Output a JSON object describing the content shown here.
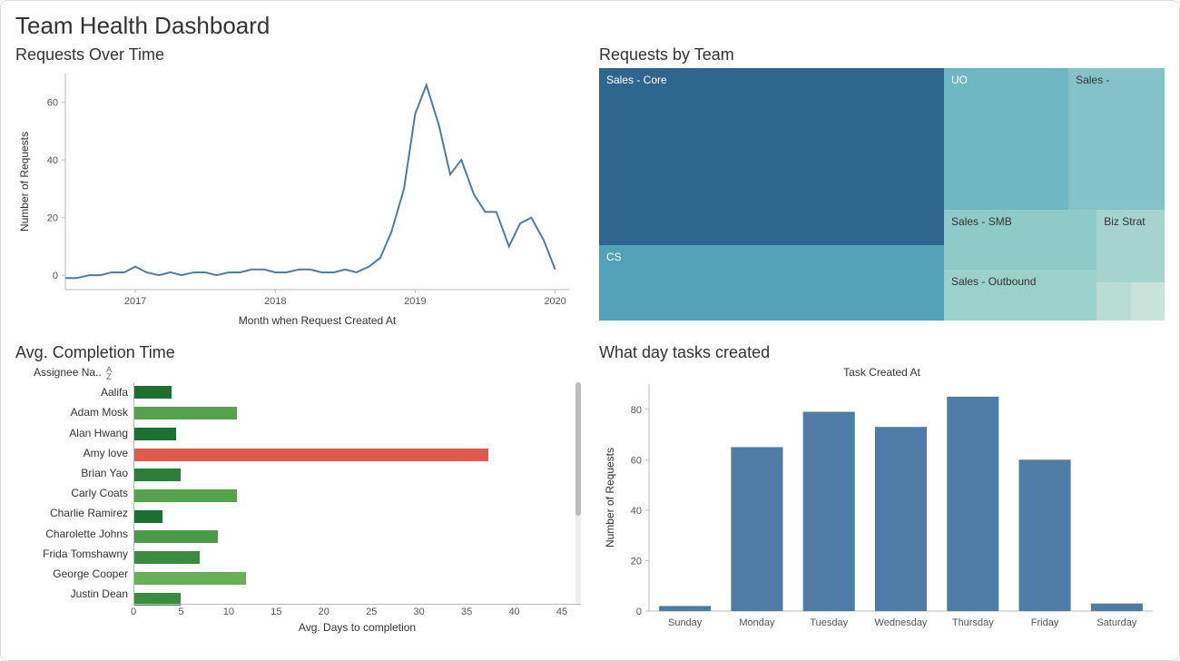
{
  "title": "Team Health Dashboard",
  "chart_data": [
    {
      "id": "requests_over_time",
      "type": "line",
      "title": "Requests Over Time",
      "xlabel": "Month when Request Created At",
      "ylabel": "Number of Requests",
      "x_ticks": [
        "2017",
        "2018",
        "2019",
        "2020"
      ],
      "y_ticks": [
        0,
        20,
        40,
        60
      ],
      "xlim": [
        2016.5,
        2020.1
      ],
      "ylim": [
        -5,
        70
      ],
      "x": [
        2016.5,
        2016.58,
        2016.67,
        2016.75,
        2016.83,
        2016.92,
        2017.0,
        2017.08,
        2017.17,
        2017.25,
        2017.33,
        2017.42,
        2017.5,
        2017.58,
        2017.67,
        2017.75,
        2017.83,
        2017.92,
        2018.0,
        2018.08,
        2018.17,
        2018.25,
        2018.33,
        2018.42,
        2018.5,
        2018.58,
        2018.67,
        2018.75,
        2018.83,
        2018.92,
        2019.0,
        2019.08,
        2019.17,
        2019.25,
        2019.33,
        2019.42,
        2019.5,
        2019.58,
        2019.67,
        2019.75,
        2019.83,
        2019.92,
        2020.0
      ],
      "values": [
        -1,
        -1,
        0,
        0,
        1,
        1,
        3,
        1,
        0,
        1,
        0,
        1,
        1,
        0,
        1,
        1,
        2,
        2,
        1,
        1,
        2,
        2,
        1,
        1,
        2,
        1,
        3,
        6,
        15,
        30,
        56,
        66,
        52,
        35,
        40,
        28,
        22,
        22,
        10,
        18,
        20,
        12,
        2
      ]
    },
    {
      "id": "requests_by_team",
      "type": "treemap",
      "title": "Requests by Team",
      "items": [
        {
          "label": "Sales - Core",
          "value": 140,
          "color": "#2f6690"
        },
        {
          "label": "CS",
          "value": 60,
          "color": "#52a1b8"
        },
        {
          "label": "UO",
          "value": 50,
          "color": "#6fb7c2"
        },
        {
          "label": "Sales -",
          "value": 35,
          "color": "#84c2c8"
        },
        {
          "label": "Sales - SMB",
          "value": 30,
          "color": "#8fcac9"
        },
        {
          "label": "Biz Strat",
          "value": 18,
          "color": "#a5d4ce"
        },
        {
          "label": "Sales - Outbound",
          "value": 20,
          "color": "#9bd0cb"
        },
        {
          "label": "",
          "value": 6,
          "color": "#b8ddd4"
        },
        {
          "label": "",
          "value": 4,
          "color": "#c6e4da"
        },
        {
          "label": "",
          "value": 3,
          "color": "#c6e4da"
        },
        {
          "label": "",
          "value": 3,
          "color": "#c6e4da"
        }
      ]
    },
    {
      "id": "avg_completion_time",
      "type": "bar",
      "orientation": "horizontal",
      "title": "Avg. Completion Time",
      "row_header": "Assignee Na..",
      "xlabel": "Avg. Days to completion",
      "x_ticks": [
        0,
        5,
        10,
        15,
        20,
        25,
        30,
        35,
        40,
        45
      ],
      "xlim": [
        0,
        47
      ],
      "categories": [
        "Aalifa",
        "Adam Mosk",
        "Alan Hwang",
        "Amy love",
        "Brian Yao",
        "Carly Coats",
        "Charlie Ramirez",
        "Charolette Johns",
        "Frida Tomshawny",
        "George Cooper",
        "Justin Dean"
      ],
      "values": [
        4,
        11,
        4.5,
        38,
        5,
        11,
        3,
        9,
        7,
        12,
        5
      ],
      "colors": [
        "#1e7030",
        "#55a14e",
        "#1e7030",
        "#e05a4e",
        "#2d7d3a",
        "#55a14e",
        "#1e7030",
        "#4a9a48",
        "#3b8c41",
        "#68b057",
        "#3b8c41"
      ]
    },
    {
      "id": "tasks_by_day",
      "type": "bar",
      "title": "What day tasks created",
      "subtitle": "Task Created At",
      "ylabel": "Number of Requests",
      "y_ticks": [
        0,
        20,
        40,
        60,
        80
      ],
      "ylim": [
        0,
        90
      ],
      "categories": [
        "Sunday",
        "Monday",
        "Tuesday",
        "Wednesday",
        "Thursday",
        "Friday",
        "Saturday"
      ],
      "values": [
        2,
        65,
        79,
        73,
        85,
        60,
        3
      ],
      "bar_color": "#4f7ca6"
    }
  ]
}
